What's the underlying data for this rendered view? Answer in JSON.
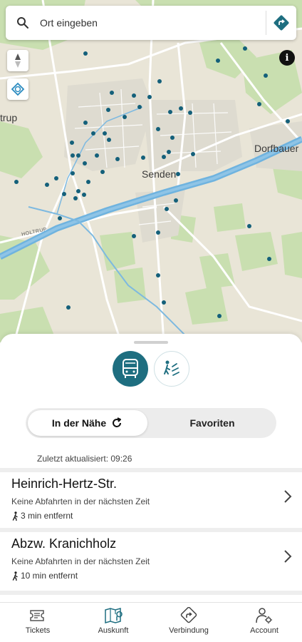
{
  "search": {
    "placeholder": "Ort eingeben",
    "search_icon": "search-icon",
    "route_icon": "directions-icon"
  },
  "map": {
    "town_labels": [
      "Senden",
      "Dorfbauer",
      "trup"
    ],
    "road_label": "HOLTRUP",
    "controls": {
      "compass_icon": "compass-icon",
      "locate_icon": "locate-icon",
      "info_label": "i"
    },
    "colors": {
      "land": "#e9e5d7",
      "green": "#c9dfb0",
      "canal": "#6fb3df",
      "stop_dot": "#14607a"
    }
  },
  "sheet": {
    "modes": [
      {
        "name": "bus",
        "icon": "bus-icon",
        "active": true
      },
      {
        "name": "walk-transfer",
        "icon": "walk-transfer-icon",
        "active": false
      }
    ],
    "segments": {
      "nearby_label": "In der Nähe",
      "favorites_label": "Favoriten",
      "refresh_icon": "refresh-icon",
      "selected": "nearby"
    },
    "updated_text": "Zuletzt aktualisiert: 09:26",
    "stops": [
      {
        "name": "Heinrich-Hertz-Str.",
        "departures": "Keine Abfahrten in der nächsten Zeit",
        "distance": "3 min entfernt"
      },
      {
        "name": "Abzw. Kranichholz",
        "departures": "Keine Abfahrten in der nächsten Zeit",
        "distance": "10 min entfernt"
      }
    ]
  },
  "nav": {
    "items": [
      {
        "label": "Tickets",
        "icon": "ticket-icon"
      },
      {
        "label": "Auskunft",
        "icon": "map-pin-icon",
        "active": true
      },
      {
        "label": "Verbindung",
        "icon": "directions-icon"
      },
      {
        "label": "Account",
        "icon": "account-icon"
      }
    ],
    "accent": "#1e6e80"
  }
}
